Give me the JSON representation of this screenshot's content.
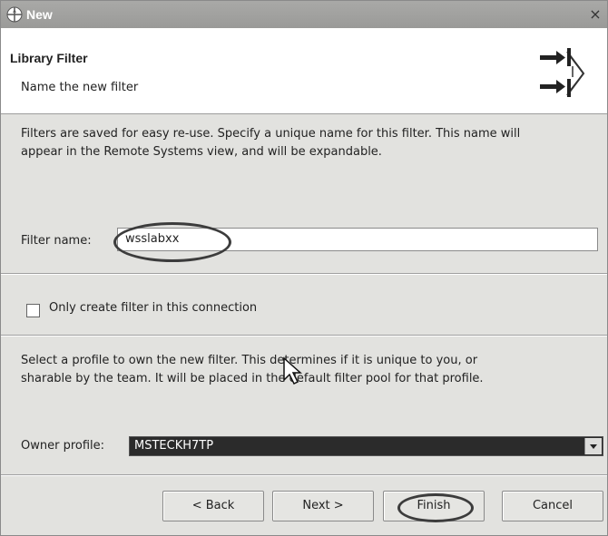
{
  "window": {
    "title": "New",
    "close_glyph": "×"
  },
  "banner": {
    "title": "Library Filter",
    "subtitle": "Name the new filter",
    "icon": "wizard-filter-arrows-icon"
  },
  "intro": {
    "line1": "Filters are saved for easy re-use. Specify a unique name for this filter. This name will",
    "line2": "appear in the Remote Systems view, and will be expandable."
  },
  "filter_name": {
    "label": "Filter name:",
    "value": "wsslabxx"
  },
  "only_connection": {
    "label": "Only create filter in this connection",
    "checked": false
  },
  "profile_help": {
    "line1": "Select a profile to own the new filter. This determines if it is unique to you, or",
    "line2": "sharable by the team. It will be placed in the default filter pool for that profile."
  },
  "owner_profile": {
    "label": "Owner profile:",
    "value": "MSTECKH7TP"
  },
  "buttons": {
    "back": "< Back",
    "next": "Next >",
    "finish": "Finish",
    "cancel": "Cancel"
  },
  "colors": {
    "titlebar": "#a0a0a0",
    "highlight_ellipse": "#3c3c3c",
    "dropdown_selected": "#2b2b2b"
  }
}
